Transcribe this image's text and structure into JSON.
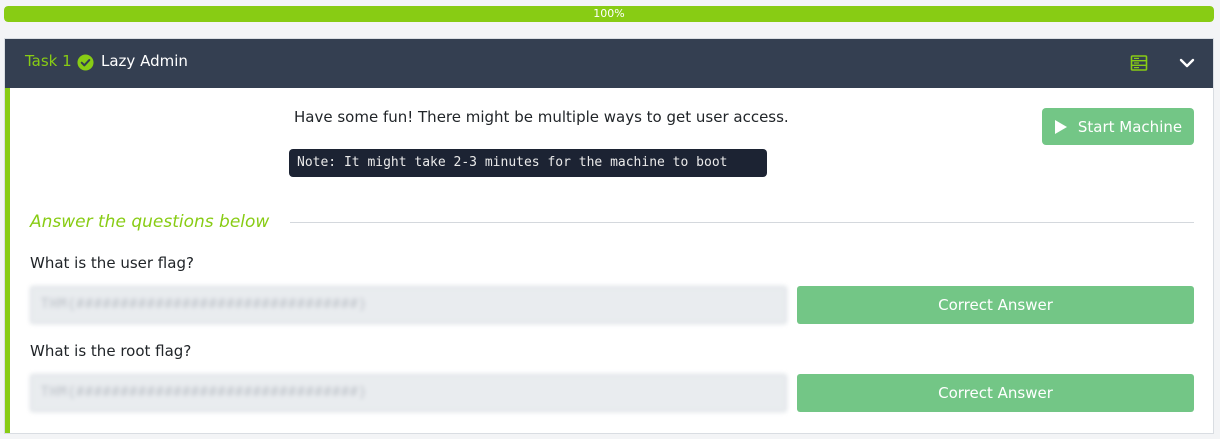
{
  "progress": {
    "label": "100%",
    "percent": 100
  },
  "task": {
    "number_label": "Task 1",
    "title": "Lazy Admin",
    "description": "Have some fun! There might be multiple ways to get user access.",
    "note": "Note: It might take 2-3 minutes for the machine to boot",
    "start_button": "Start Machine",
    "answer_heading": "Answer the questions below",
    "questions": [
      {
        "text": "What is the user flag?",
        "answer": "THM{################################}",
        "button": "Correct Answer"
      },
      {
        "text": "What is the root flag?",
        "answer": "THM{################################}",
        "button": "Correct Answer"
      }
    ]
  },
  "colors": {
    "accent": "#88cc14",
    "header_bg": "#343f51",
    "button_green": "#73c686",
    "note_bg": "#1c2333"
  },
  "icons": {
    "completed": "check-circle-icon",
    "server": "server-icon",
    "collapse": "chevron-down-icon",
    "start": "play-icon"
  }
}
